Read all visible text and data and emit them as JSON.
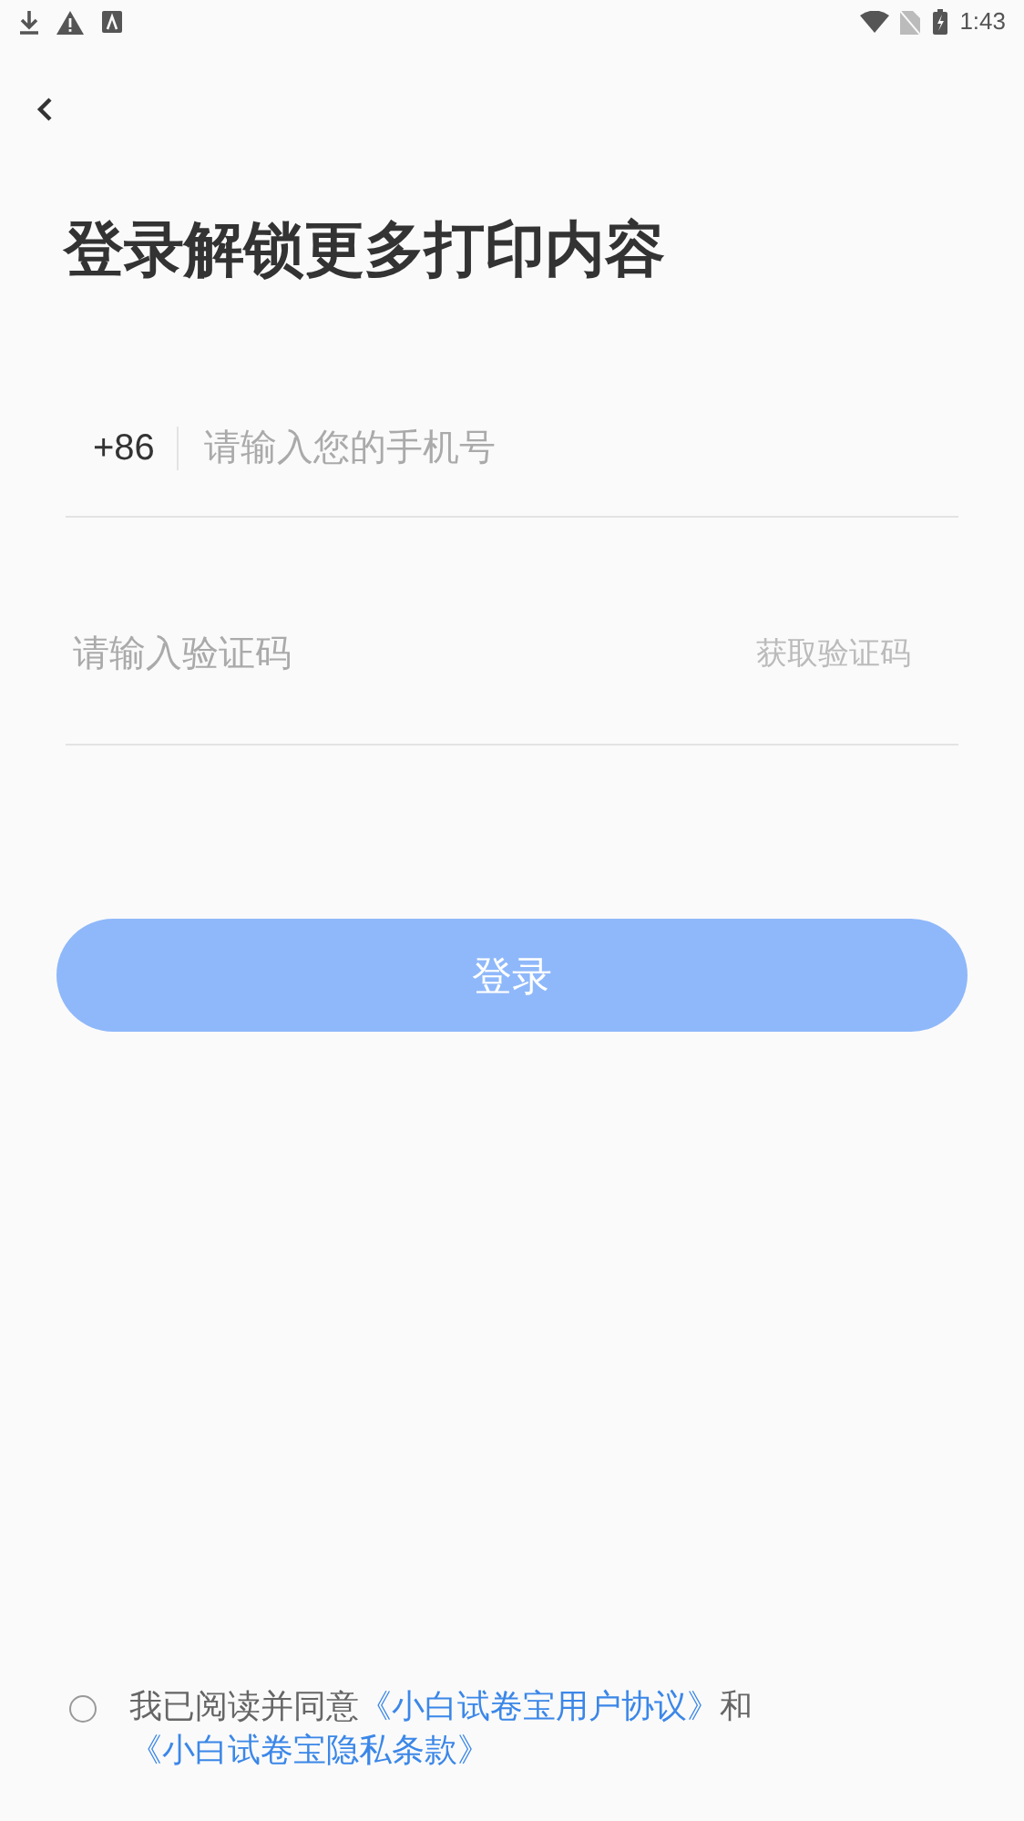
{
  "status_bar": {
    "time": "1:43"
  },
  "title": "登录解锁更多打印内容",
  "phone_field": {
    "country_code": "+86",
    "placeholder": "请输入您的手机号"
  },
  "code_field": {
    "placeholder": "请输入验证码",
    "action": "获取验证码"
  },
  "login_button": {
    "label": "登录",
    "disabled": true
  },
  "agreement": {
    "checked": false,
    "text": "我已阅读并同意",
    "links": [
      "《小白试卷宝用户协议》",
      "《小白试卷宝隐私条款》"
    ],
    "joiner": "和"
  }
}
